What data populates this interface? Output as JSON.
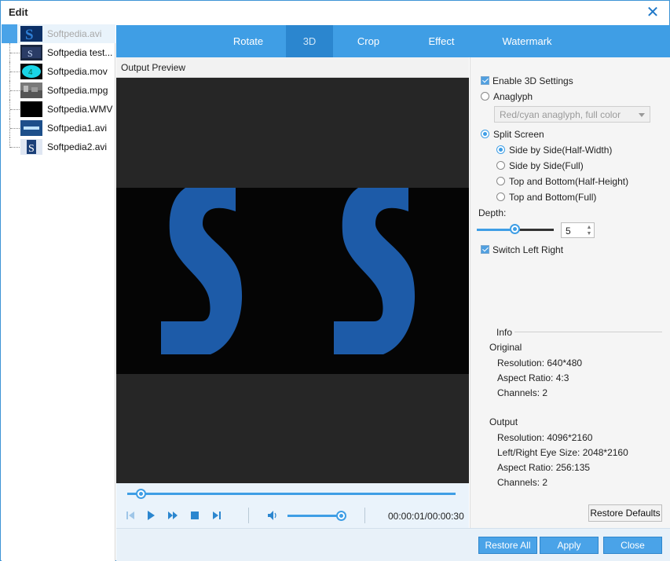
{
  "window": {
    "title": "Edit",
    "close_icon": "close-icon"
  },
  "files": [
    {
      "name": "Softpedia.avi"
    },
    {
      "name": "Softpedia test...."
    },
    {
      "name": "Softpedia.mov"
    },
    {
      "name": "Softpedia.mpg"
    },
    {
      "name": "Softpedia.WMV"
    },
    {
      "name": "Softpedia1.avi"
    },
    {
      "name": "Softpedia2.avi"
    }
  ],
  "tabs": [
    {
      "label": "Rotate"
    },
    {
      "label": "3D"
    },
    {
      "label": "Crop"
    },
    {
      "label": "Effect"
    },
    {
      "label": "Watermark"
    }
  ],
  "preview": {
    "label": "Output Preview"
  },
  "player": {
    "time": "00:00:01/00:00:30",
    "progress": 0.04,
    "volume": 0.86
  },
  "settings": {
    "enable_3d": "Enable 3D Settings",
    "anaglyph": "Anaglyph",
    "anaglyph_select": "Red/cyan anaglyph, full color",
    "split_screen": "Split Screen",
    "options": [
      "Side by Side(Half-Width)",
      "Side by Side(Full)",
      "Top and Bottom(Half-Height)",
      "Top and Bottom(Full)"
    ],
    "depth_label": "Depth:",
    "depth_value": "5",
    "switch_lr": "Switch Left Right",
    "restore_defaults": "Restore Defaults"
  },
  "info": {
    "heading": "Info",
    "original_heading": "Original",
    "original": [
      "Resolution: 640*480",
      "Aspect Ratio: 4:3",
      "Channels: 2"
    ],
    "output_heading": "Output",
    "output": [
      "Resolution: 4096*2160",
      "Left/Right Eye Size: 2048*2160",
      "Aspect Ratio: 256:135",
      "Channels: 2"
    ]
  },
  "footer": {
    "restore_all": "Restore All",
    "apply": "Apply",
    "close": "Close"
  },
  "colors": {
    "accent": "#3f9ee5",
    "logo_blue": "#1d5ba8"
  }
}
